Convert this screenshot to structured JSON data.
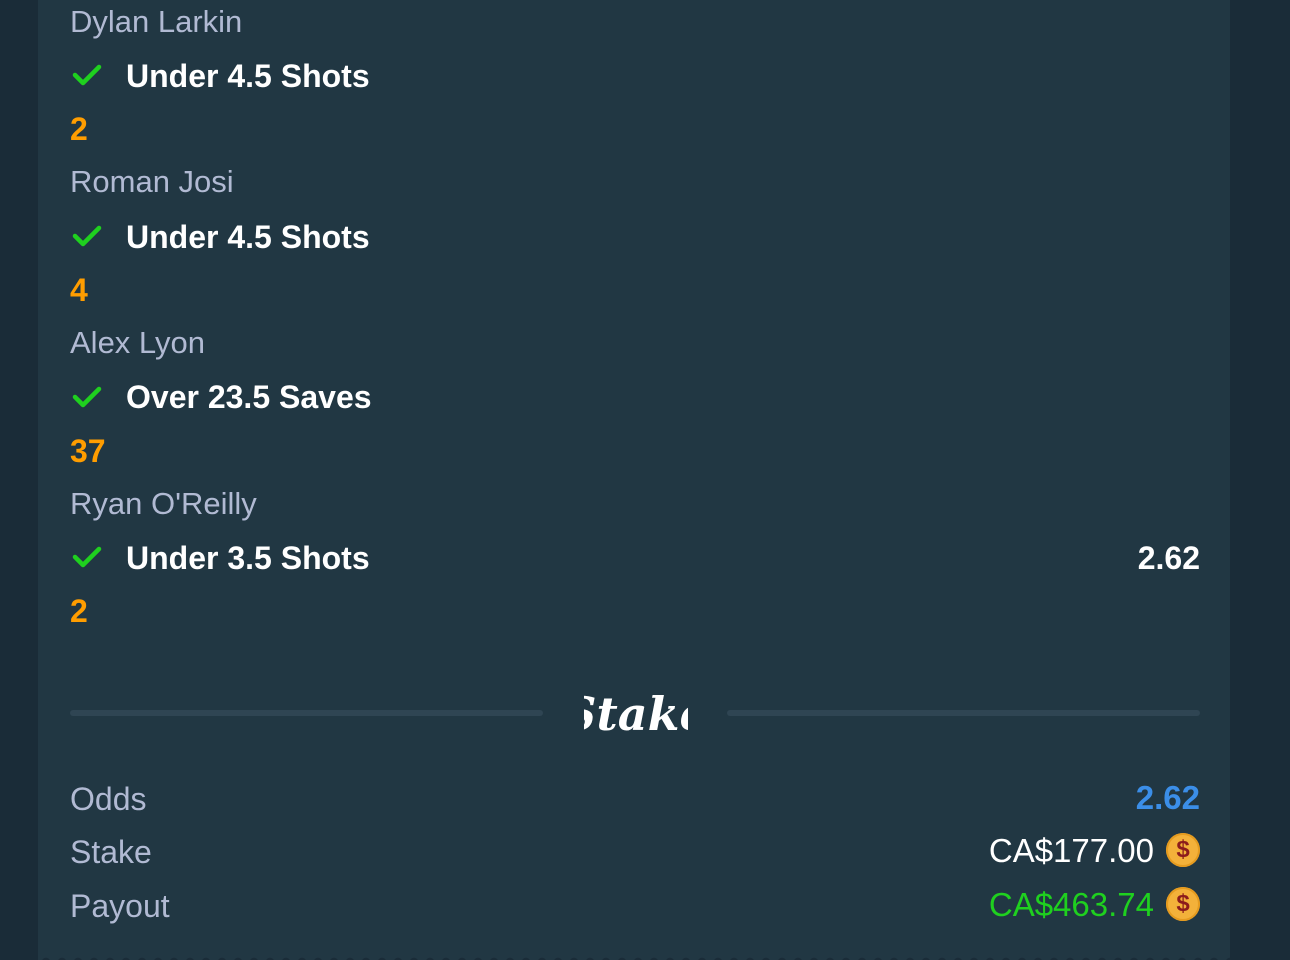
{
  "legs": [
    {
      "player": "Dylan Larkin",
      "market": "Under 4.5 Shots",
      "result": "2",
      "odds": ""
    },
    {
      "player": "Roman Josi",
      "market": "Under 4.5 Shots",
      "result": "4",
      "odds": ""
    },
    {
      "player": "Alex Lyon",
      "market": "Over 23.5 Saves",
      "result": "37",
      "odds": ""
    },
    {
      "player": "Ryan O'Reilly",
      "market": "Under 3.5 Shots",
      "result": "2",
      "odds": "2.62"
    }
  ],
  "brand": {
    "logo_text": "Stake"
  },
  "summary": {
    "odds_label": "Odds",
    "odds_value": "2.62",
    "stake_label": "Stake",
    "stake_value": "CA$177.00",
    "payout_label": "Payout",
    "payout_value": "CA$463.74",
    "currency_icon": "$"
  },
  "colors": {
    "background": "#1a2c38",
    "card": "#213743",
    "check": "#1fd01f",
    "result": "#ff9d00",
    "odds": "#3b8ee8",
    "payout": "#1fd01f",
    "coin": "#f3b13a"
  },
  "icons": [
    "check-icon",
    "stake-logo",
    "coin-icon"
  ]
}
